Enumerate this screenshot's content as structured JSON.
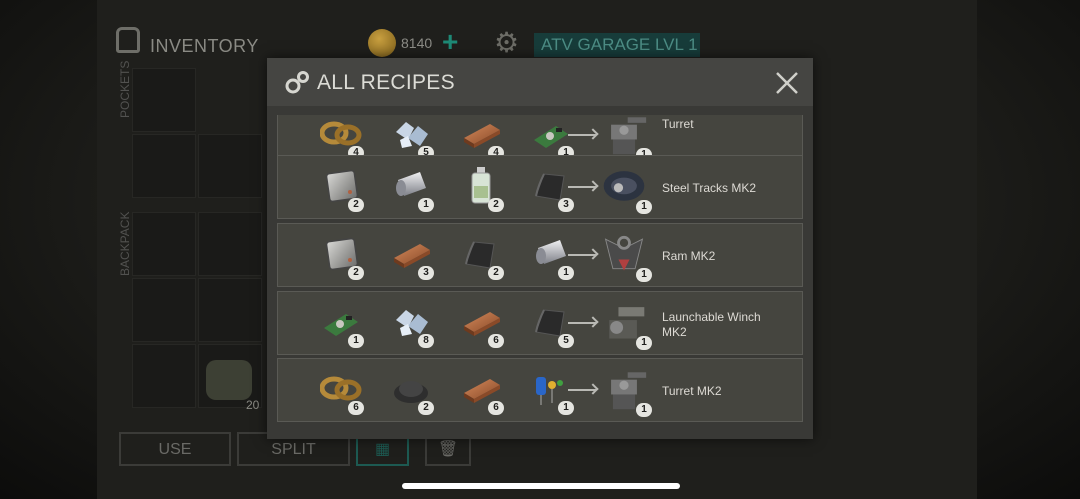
{
  "background": {
    "inventory_title": "INVENTORY",
    "coins": "8140",
    "plus_symbol": "+",
    "garage_label": "ATV GARAGE LVL 1",
    "pockets_label": "POCKETS",
    "backpack_label": "BACKPACK",
    "medkit_count": "20",
    "use_label": "USE",
    "split_label": "SPLIT"
  },
  "modal": {
    "title": "ALL RECIPES",
    "close_icon": "close-x-icon"
  },
  "recipes": [
    {
      "ingredients": [
        {
          "icon": "leather-straps-icon",
          "qty": "4"
        },
        {
          "icon": "ice-crystals-icon",
          "qty": "5"
        },
        {
          "icon": "copper-ingot-icon",
          "qty": "4"
        },
        {
          "icon": "circuit-board-icon",
          "qty": "1"
        }
      ],
      "result": {
        "name": "Turret",
        "qty": "1",
        "icon": "turret-icon"
      }
    },
    {
      "ingredients": [
        {
          "icon": "steel-plate-icon",
          "qty": "2"
        },
        {
          "icon": "steel-roll-icon",
          "qty": "1"
        },
        {
          "icon": "glass-bottle-icon",
          "qty": "2"
        },
        {
          "icon": "rubber-sheet-icon",
          "qty": "3"
        }
      ],
      "result": {
        "name": "Steel Tracks MK2",
        "qty": "1",
        "icon": "steel-tracks-icon"
      }
    },
    {
      "ingredients": [
        {
          "icon": "steel-plate-icon",
          "qty": "2"
        },
        {
          "icon": "copper-ingot-icon",
          "qty": "3"
        },
        {
          "icon": "rubber-sheet-icon",
          "qty": "2"
        },
        {
          "icon": "steel-roll-icon",
          "qty": "1"
        }
      ],
      "result": {
        "name": "Ram MK2",
        "qty": "1",
        "icon": "ram-icon"
      }
    },
    {
      "ingredients": [
        {
          "icon": "circuit-board-icon",
          "qty": "1"
        },
        {
          "icon": "ice-crystals-icon",
          "qty": "8"
        },
        {
          "icon": "copper-ingot-icon",
          "qty": "6"
        },
        {
          "icon": "rubber-sheet-icon",
          "qty": "5"
        }
      ],
      "result": {
        "name": "Launchable Winch MK2",
        "qty": "1",
        "icon": "winch-icon"
      }
    },
    {
      "ingredients": [
        {
          "icon": "leather-straps-icon",
          "qty": "6"
        },
        {
          "icon": "coal-pile-icon",
          "qty": "2"
        },
        {
          "icon": "copper-ingot-icon",
          "qty": "6"
        },
        {
          "icon": "electronic-parts-icon",
          "qty": "1"
        }
      ],
      "result": {
        "name": "Turret MK2",
        "qty": "1",
        "icon": "turret-icon"
      }
    }
  ],
  "colors": {
    "accent_teal": "#1e8a76",
    "modal_bg": "#393936",
    "row_bg": "#45453f"
  }
}
